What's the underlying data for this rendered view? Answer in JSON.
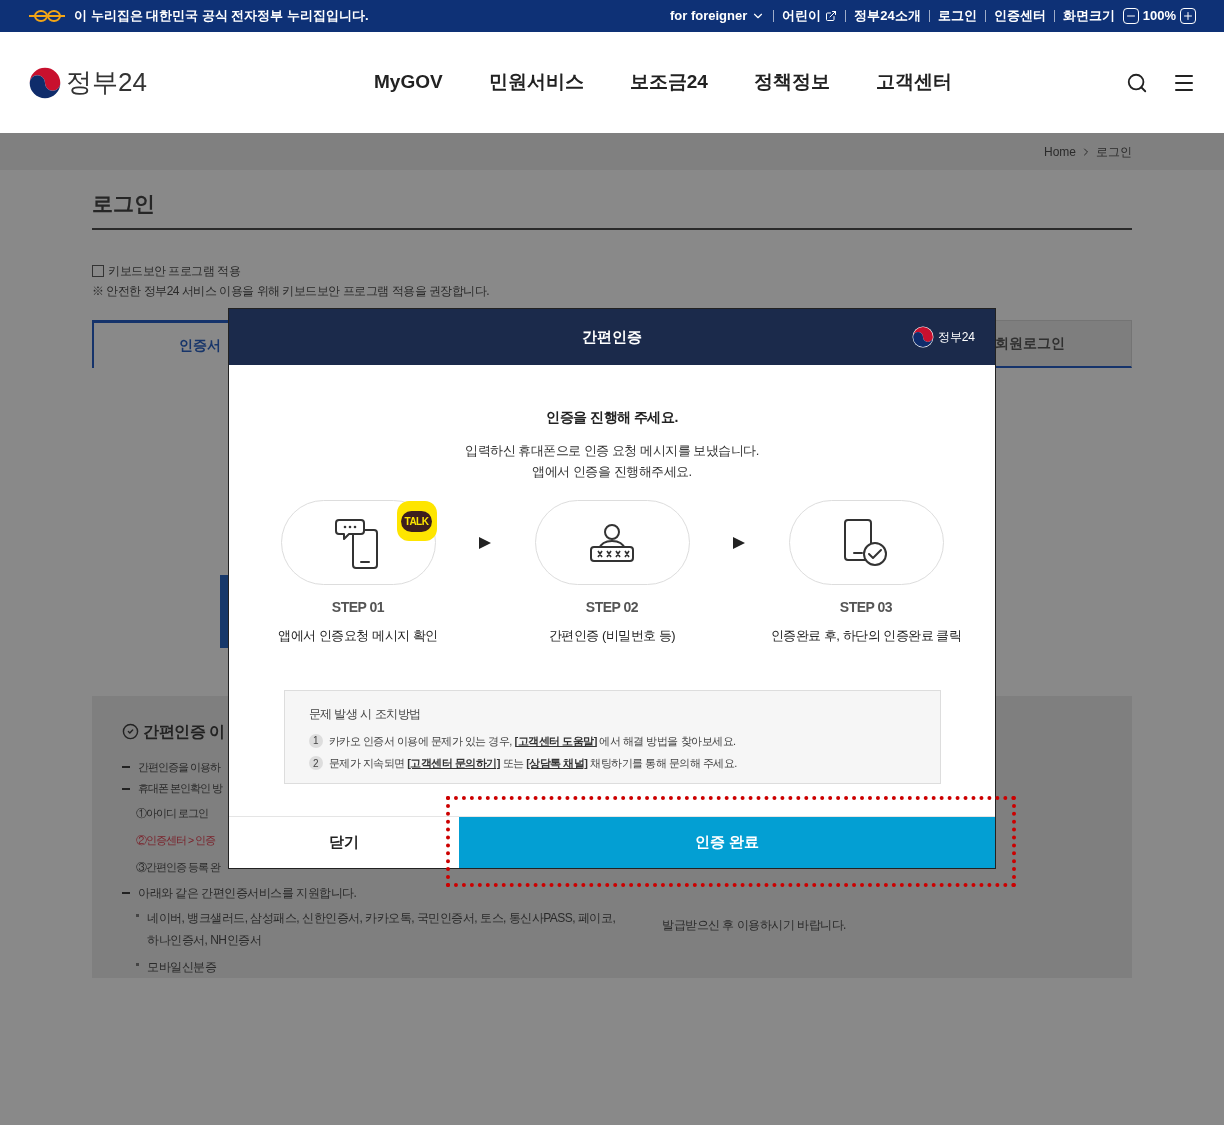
{
  "top_bar": {
    "notice": "이 누리집은 대한민국 공식 전자정부 누리집입니다.",
    "links": [
      {
        "label": "for foreigner",
        "kind": "dropdown"
      },
      {
        "label": "어린이",
        "kind": "external"
      },
      {
        "label": "정부24소개",
        "kind": "plain"
      },
      {
        "label": "로그인",
        "kind": "plain"
      },
      {
        "label": "인증센터",
        "kind": "plain"
      }
    ],
    "zoom": {
      "label": "화면크기",
      "value": "100%"
    }
  },
  "header": {
    "logo": "정부24",
    "nav": [
      "MyGOV",
      "민원서비스",
      "보조금24",
      "정책정보",
      "고객센터"
    ]
  },
  "breadcrumb": [
    "Home",
    "로그인"
  ],
  "page_title": "로그인",
  "keyboard_security": {
    "label": "키보드보안 프로그램 적용",
    "checked": false,
    "note": "※ 안전한 정부24 서비스 이용을 위해 키보드보안 프로그램 적용을 권장합니다."
  },
  "tabs": [
    {
      "label": "인증서",
      "selected": true
    },
    {
      "label": "회원로그인",
      "selected": false
    }
  ],
  "guide": {
    "title": "간편인증 이",
    "items": [
      {
        "text": "간편인증을 이용하"
      },
      {
        "text": "휴대폰 본인확인 방",
        "children": [
          {
            "text": "①아이디 로그인",
            "kind": "plain",
            "highlighted": false
          },
          {
            "text": "②인증센터 > 인증",
            "kind": "plain",
            "highlighted": true
          },
          {
            "text": "③간편인증 등록 완",
            "kind": "plain",
            "highlighted": false
          }
        ]
      },
      {
        "text": "아래와 같은 간편인증서비스를 지원합니다.",
        "children": [
          {
            "text": "네이버, 뱅크샐러드, 삼성패스, 신한인증서, 카카오톡, 국민인증서, 토스, 통신사PASS, 페이코, 하나인증서, NH인증서",
            "kind": "bullet",
            "highlighted": false
          },
          {
            "text": "모바일신분증",
            "kind": "bullet",
            "highlighted": false
          }
        ]
      }
    ],
    "side_note": "발급받으신 후 이용하시기 바랍니다."
  },
  "modal": {
    "title": "간편인증",
    "logo": "정부24",
    "heading": "인증을 진행해 주세요.",
    "description": [
      "입력하신 휴대폰으로 인증 요청 메시지를 보냈습니다.",
      "앱에서 인증을 진행해주세요."
    ],
    "steps": [
      {
        "kind": "message",
        "badge": "TALK",
        "label": "STEP 01",
        "text": "앱에서 인증요청 메시지 확인"
      },
      {
        "kind": "password",
        "label": "STEP 02",
        "text": "간편인증 (비밀번호 등)"
      },
      {
        "kind": "verified",
        "label": "STEP 03",
        "text": "인증완료 후, 하단의 인증완료 클릭"
      }
    ],
    "help": {
      "title": "문제 발생 시 조치방법",
      "items": [
        {
          "number": "1",
          "parts": [
            {
              "kind": "text",
              "text": "카카오 인증서 이용에 문제가 있는 경우, "
            },
            {
              "kind": "link",
              "text": "[고객센터 도움말]"
            },
            {
              "kind": "text",
              "text": " 에서 해결 방법을 찾아보세요."
            }
          ]
        },
        {
          "number": "2",
          "parts": [
            {
              "kind": "text",
              "text": "문제가 지속되면 "
            },
            {
              "kind": "link",
              "text": "[고객센터 문의하기]"
            },
            {
              "kind": "text",
              "text": " 또는 "
            },
            {
              "kind": "link",
              "text": "[상담톡 채널]"
            },
            {
              "kind": "text",
              "text": " 채팅하기를 통해 문의해 주세요."
            }
          ]
        }
      ]
    },
    "buttons": [
      {
        "label": "닫기",
        "kind": "secondary"
      },
      {
        "label": "인증 완료",
        "kind": "primary"
      }
    ]
  }
}
